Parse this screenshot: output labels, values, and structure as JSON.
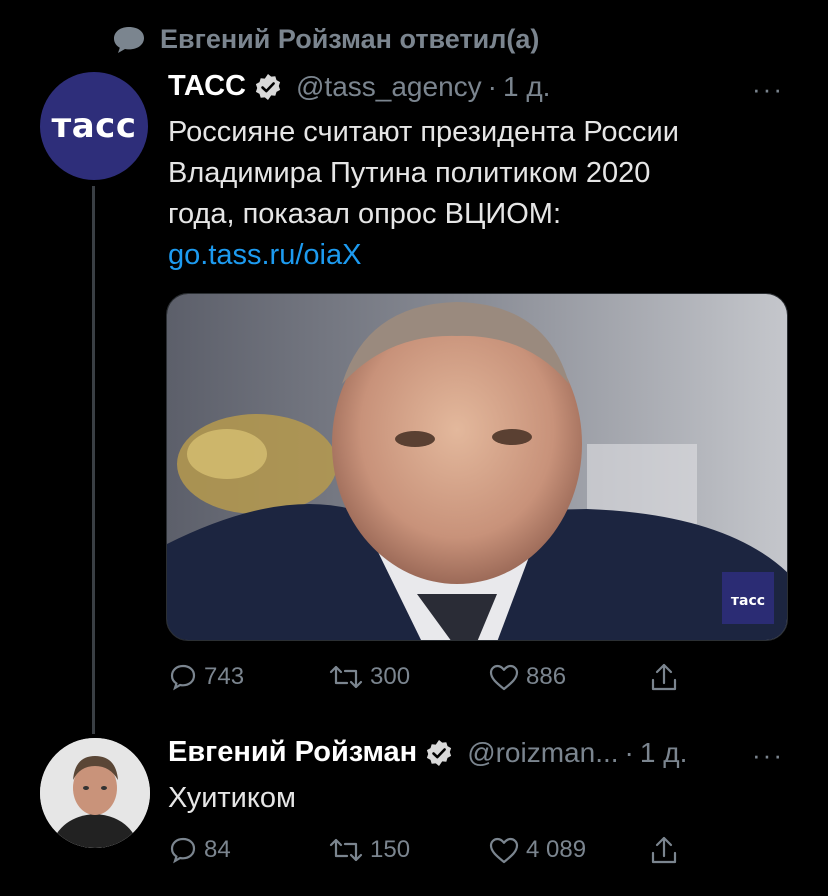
{
  "context": {
    "text": "Евгений Ройзман ответил(а)",
    "icon": "speech-bubble-icon"
  },
  "tweet1": {
    "avatar_text": "тасс",
    "name": "ТАСС",
    "handle": "@tass_agency",
    "separator": "·",
    "time": "1 д.",
    "more": "···",
    "text_lines": [
      "Россияне считают президента России",
      "Владимира Путина политиком 2020",
      "года, показал опрос ВЦИОМ:"
    ],
    "link": "go.tass.ru/oiaX",
    "media_watermark": "тасс",
    "replies": "743",
    "retweets": "300",
    "likes": "886"
  },
  "tweet2": {
    "name": "Евгений Ройзман",
    "handle": "@roizman...",
    "separator": "·",
    "time": "1 д.",
    "more": "···",
    "text": "Хуитиком",
    "replies": "84",
    "retweets": "150",
    "likes": "4 089"
  },
  "colors": {
    "background": "#000000",
    "muted": "#7b858f",
    "link": "#1d9bf0",
    "verified": "#d9d9d9",
    "tass_blue": "#2e2e7a"
  }
}
